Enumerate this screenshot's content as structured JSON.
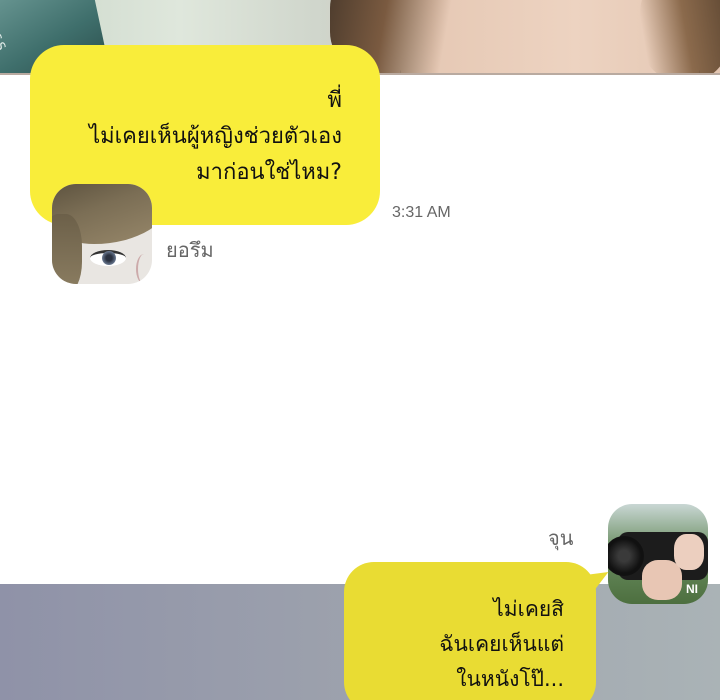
{
  "top_panel": {
    "bottle_text": "NESS"
  },
  "messages": [
    {
      "lines": [
        "พี่",
        "ไม่เคยเห็นผู้หญิงช่วยตัวเอง",
        "มาก่อนใช่ไหม?"
      ],
      "time": "3:31 AM",
      "sender": "ยอรึม"
    },
    {
      "lines": [
        "ไม่เคยสิ",
        "ฉันเคยเห็นแต่",
        "ในหนังโป๊..."
      ],
      "sender": "จุน",
      "avatar_brand": "NI"
    }
  ],
  "colors": {
    "bubble": "#f9ed3a",
    "bubble_dim": "#e9dc33",
    "bottom_bg": "#9da2ad"
  }
}
